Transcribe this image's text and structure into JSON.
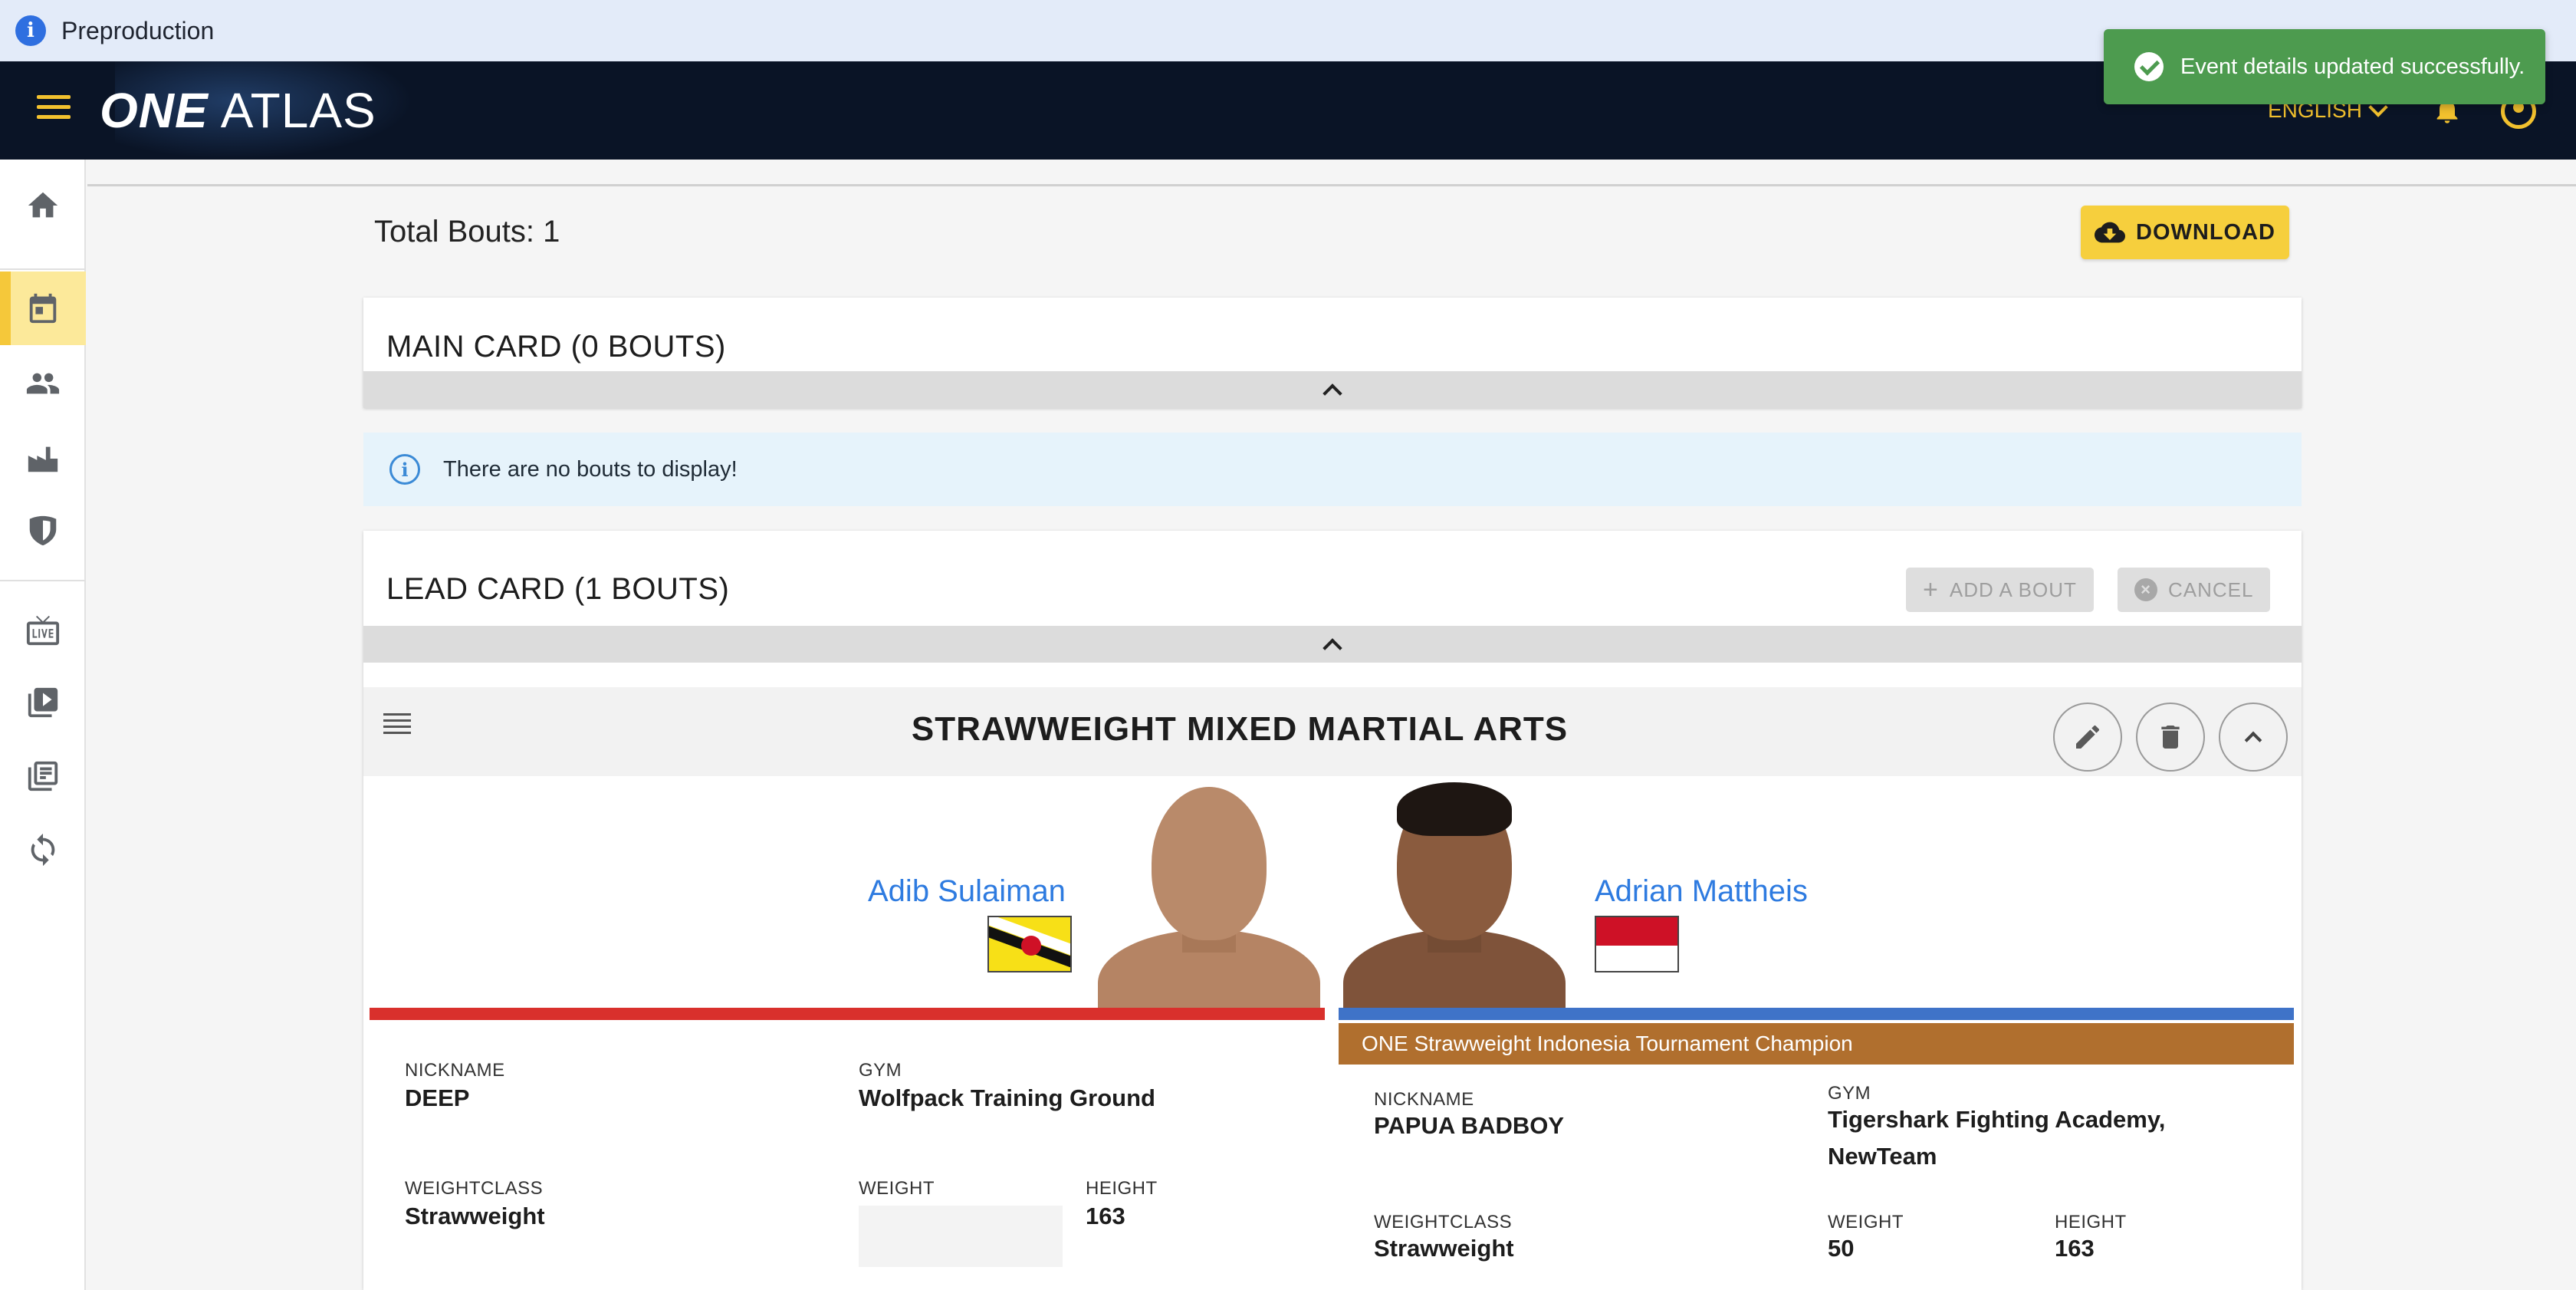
{
  "environment": {
    "label": "Preproduction"
  },
  "appbar": {
    "logo_one": "ONE",
    "logo_atlas": "ATLAS",
    "language": "ENGLISH"
  },
  "toast": {
    "message": "Event details updated successfully."
  },
  "sidebar": {
    "items": [
      {
        "name": "home",
        "icon": "home-icon"
      },
      {
        "name": "events",
        "icon": "calendar-icon",
        "active": true
      },
      {
        "name": "athletes",
        "icon": "people-icon"
      },
      {
        "name": "venues",
        "icon": "factory-icon"
      },
      {
        "name": "promotions",
        "icon": "shield-icon"
      },
      {
        "name": "live",
        "icon": "live-tv-icon"
      },
      {
        "name": "videos",
        "icon": "video-library-icon"
      },
      {
        "name": "collections",
        "icon": "library-icon"
      },
      {
        "name": "sync",
        "icon": "sync-icon"
      }
    ]
  },
  "main": {
    "total_bouts": "Total Bouts: 1",
    "download_label": "DOWNLOAD",
    "main_card": {
      "title": "MAIN CARD (0 BOUTS)",
      "empty_message": "There are no bouts to display!"
    },
    "lead_card": {
      "title": "LEAD CARD (1 BOUTS)",
      "add_bout_label": "ADD A BOUT",
      "cancel_label": "CANCEL"
    },
    "bout": {
      "title": "STRAWWEIGHT MIXED MARTIAL ARTS",
      "red_corner": {
        "name": "Adib Sulaiman",
        "flag": "Brunei",
        "corner_color": "#d9302c",
        "nickname_label": "NICKNAME",
        "nickname": "DEEP",
        "gym_label": "GYM",
        "gym": "Wolfpack Training Ground",
        "weightclass_label": "WEIGHTCLASS",
        "weightclass": "Strawweight",
        "weight_label": "WEIGHT",
        "weight": "",
        "height_label": "HEIGHT",
        "height": "163"
      },
      "blue_corner": {
        "name": "Adrian Mattheis",
        "flag": "Indonesia",
        "corner_color": "#3f73c8",
        "title_strip": "ONE Strawweight Indonesia Tournament Champion",
        "nickname_label": "NICKNAME",
        "nickname": "PAPUA BADBOY",
        "gym_label": "GYM",
        "gym_line1": "Tigershark Fighting Academy,",
        "gym_line2": "NewTeam",
        "weightclass_label": "WEIGHTCLASS",
        "weightclass": "Strawweight",
        "weight_label": "WEIGHT",
        "weight": "50",
        "height_label": "HEIGHT",
        "height": "163"
      }
    }
  }
}
